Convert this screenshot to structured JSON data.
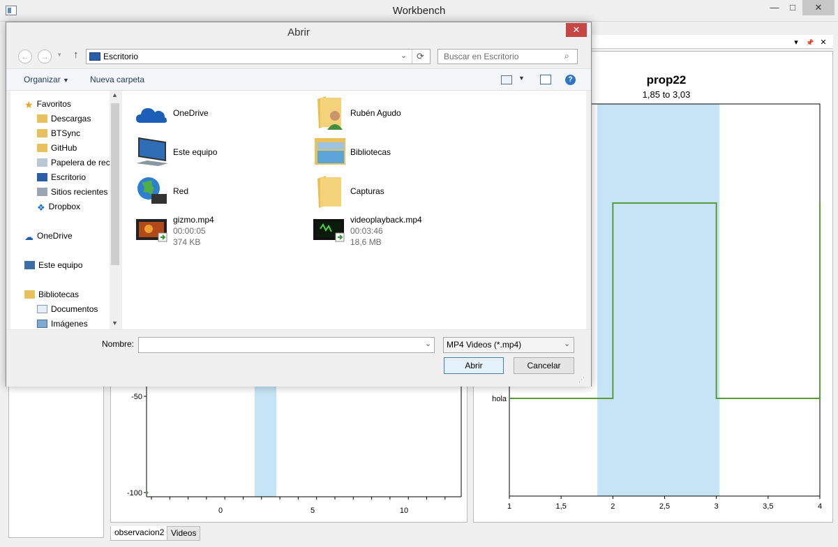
{
  "window": {
    "title": "Workbench",
    "min": "—",
    "max": "□",
    "close": "✕"
  },
  "panel_controls": {
    "menu": "▾",
    "pin": "📌",
    "close": "✕"
  },
  "tabs": [
    {
      "label": "observacion2"
    },
    {
      "label": "Videos"
    }
  ],
  "dialog": {
    "title": "Abrir",
    "close": "✕",
    "address": "Escritorio",
    "search_placeholder": "Buscar en Escritorio",
    "organize": "Organizar",
    "new_folder": "Nueva carpeta",
    "nav": {
      "favorites_header": "Favoritos",
      "favorites": [
        "Descargas",
        "BTSync",
        "GitHub",
        "Papelera de reciclaje",
        "Escritorio",
        "Sitios recientes",
        "Dropbox"
      ],
      "onedrive": "OneDrive",
      "this_pc": "Este equipo",
      "libraries_header": "Bibliotecas",
      "libraries": [
        "Documentos",
        "Imágenes"
      ]
    },
    "items": [
      {
        "name": "OneDrive"
      },
      {
        "name": "Rubén Agudo"
      },
      {
        "name": "Este equipo"
      },
      {
        "name": "Bibliotecas"
      },
      {
        "name": "Red"
      },
      {
        "name": "Capturas"
      },
      {
        "name": "gizmo.mp4",
        "duration": "00:00:05",
        "size": "374 KB"
      },
      {
        "name": "videoplayback.mp4",
        "duration": "00:03:46",
        "size": "18,6 MB"
      }
    ],
    "name_label": "Nombre:",
    "name_value": "",
    "filter": "MP4 Videos (*.mp4)",
    "open": "Abrir",
    "cancel": "Cancelar"
  },
  "chart_data": [
    {
      "type": "line",
      "title": "prop22",
      "subtitle": "1,85 to 3,03",
      "x_ticks": [
        "1",
        "1,5",
        "2",
        "2,5",
        "3",
        "3,5",
        "4"
      ],
      "xlim": [
        1,
        4
      ],
      "y_ticks": [
        "hola"
      ],
      "highlight": [
        1.85,
        3.03
      ],
      "series": [
        {
          "color": "#5a9a3a",
          "x": [
            1,
            2,
            2,
            3,
            3,
            4,
            4
          ],
          "y": [
            0,
            0,
            1,
            1,
            0,
            0,
            1
          ]
        }
      ]
    },
    {
      "type": "scatter",
      "x_ticks": [
        "0",
        "5",
        "10"
      ],
      "y_ticks": [
        "-50",
        "-100"
      ],
      "highlight": [
        1.85,
        3.03
      ]
    }
  ]
}
